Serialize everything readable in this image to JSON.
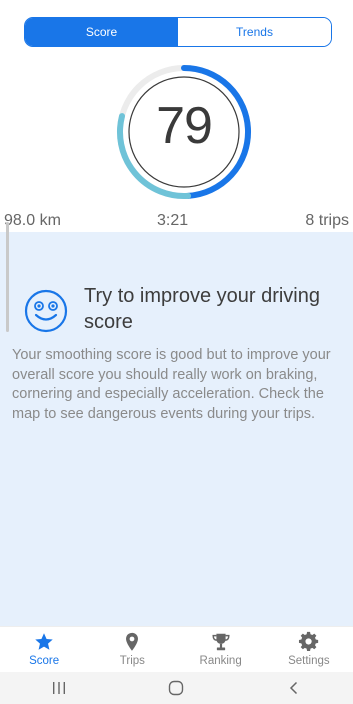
{
  "tabs": {
    "score": "Score",
    "trends": "Trends"
  },
  "score": {
    "value": "79",
    "progress": 0.79
  },
  "stats": {
    "distance": "98.0 km",
    "duration": "3:21",
    "trips": "8 trips"
  },
  "advice": {
    "icon": "smiley-icon",
    "title": "Try to improve your driving score",
    "body": "Your smoothing score is good but to improve your overall score you should really work on braking, cornering and especially acceleration. Check the map to see dangerous events during your trips."
  },
  "nav": [
    {
      "label": "Score",
      "icon": "star-icon",
      "active": true
    },
    {
      "label": "Trips",
      "icon": "map-pin-icon",
      "active": false
    },
    {
      "label": "Ranking",
      "icon": "trophy-icon",
      "active": false
    },
    {
      "label": "Settings",
      "icon": "gear-icon",
      "active": false
    }
  ],
  "colors": {
    "accent": "#1976e8",
    "gauge_teal": "#6fc3d8",
    "panel_bg": "#e6f0fc"
  }
}
